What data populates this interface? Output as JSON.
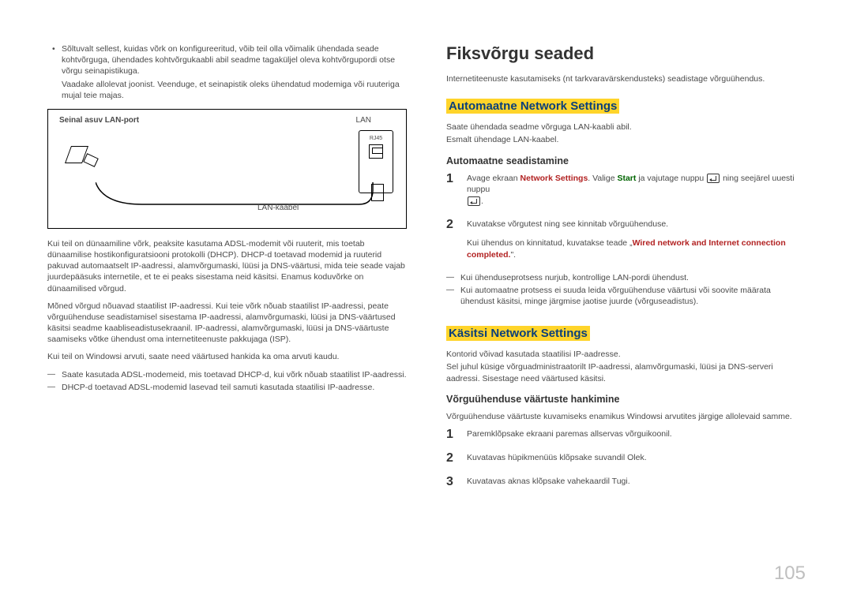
{
  "left": {
    "bullet1": "Sõltuvalt sellest, kuidas võrk on konfigureeritud, võib teil olla võimalik ühendada seade kohtvõrguga, ühendades kohtvõrgukaabli abil seadme tagaküljel oleva kohtvõrgupordi otse võrgu seinapistikuga.",
    "bullet1_extra": "Vaadake allolevat joonist. Veenduge, et seinapistik oleks ühendatud modemiga või ruuteriga mujal teie majas.",
    "diagram": {
      "wall_label": "Seinal asuv LAN-port",
      "lan": "LAN",
      "rj45": "RJ45",
      "cable": "LAN-kaabel"
    },
    "p1": "Kui teil on dünaamiline võrk, peaksite kasutama ADSL-modemit või ruuterit, mis toetab dünaamilise hostikonfiguratsiooni protokolli (DHCP). DHCP-d toetavad modemid ja ruuterid pakuvad automaatselt IP-aadressi, alamvõrgumaski, lüüsi ja DNS-väärtusi, mida teie seade vajab juurdepääsuks internetile, et te ei peaks sisestama neid käsitsi. Enamus koduvõrke on dünaamilised võrgud.",
    "p2": "Mõned võrgud nõuavad staatilist IP-aadressi. Kui teie võrk nõuab staatilist IP-aadressi, peate võrguühenduse seadistamisel sisestama IP-aadressi, alamvõrgumaski, lüüsi ja DNS-väärtused käsitsi seadme kaabliseadistusekraanil. IP-aadressi, alamvõrgumaski, lüüsi ja DNS-väärtuste saamiseks võtke ühendust oma internetiteenuste pakkujaga (ISP).",
    "p3": "Kui teil on Windowsi arvuti, saate need väärtused hankida ka oma arvuti kaudu.",
    "dash1": "Saate kasutada ADSL-modemeid, mis toetavad DHCP-d, kui võrk nõuab staatilist IP-aadressi.",
    "dash2": "DHCP-d toetavad ADSL-modemid lasevad teil samuti kasutada staatilisi IP-aadresse."
  },
  "right": {
    "h1": "Fiksvõrgu seaded",
    "intro": "Internetiteenuste kasutamiseks (nt tarkvaravärskendusteks) seadistage võrguühendus.",
    "auto": {
      "heading": "Automaatne Network Settings",
      "p1": "Saate ühendada seadme võrguga LAN-kaabli abil.",
      "p2": "Esmalt ühendage LAN-kaabel.",
      "sub": "Automaatne seadistamine",
      "step1_a": "Avage ekraan ",
      "step1_ns": "Network Settings",
      "step1_b": ". Valige ",
      "step1_start": "Start",
      "step1_c": " ja vajutage nuppu ",
      "step1_d": " ning seejärel uuesti nuppu ",
      "step1_e": ".",
      "step2": "Kuvatakse võrgutest ning see kinnitab võrguühenduse.",
      "step2_extra_a": "Kui ühendus on kinnitatud, kuvatakse teade „",
      "step2_extra_red": "Wired network and Internet connection completed.",
      "step2_extra_b": "\".",
      "dash1": "Kui ühenduseprotsess nurjub, kontrollige LAN-pordi ühendust.",
      "dash2": "Kui automaatne protsess ei suuda leida võrguühenduse väärtusi või soovite määrata ühendust käsitsi, minge järgmise jaotise juurde (võrguseadistus)."
    },
    "manual": {
      "heading": "Käsitsi Network Settings",
      "p1": "Kontorid võivad kasutada staatilisi IP-aadresse.",
      "p2": "Sel juhul küsige võrguadministraatorilt IP-aadressi, alamvõrgumaski, lüüsi ja DNS-serveri aadressi. Sisestage need väärtused käsitsi.",
      "sub": "Võrguühenduse väärtuste hankimine",
      "intro": "Võrguühenduse väärtuste kuvamiseks enamikus Windowsi arvutites järgige allolevaid samme.",
      "step1": "Paremklõpsake ekraani paremas allservas võrguikoonil.",
      "step2": "Kuvatavas hüpikmenüüs klõpsake suvandil Olek.",
      "step3": "Kuvatavas aknas klõpsake vahekaardil Tugi."
    }
  },
  "pagenum": "105"
}
